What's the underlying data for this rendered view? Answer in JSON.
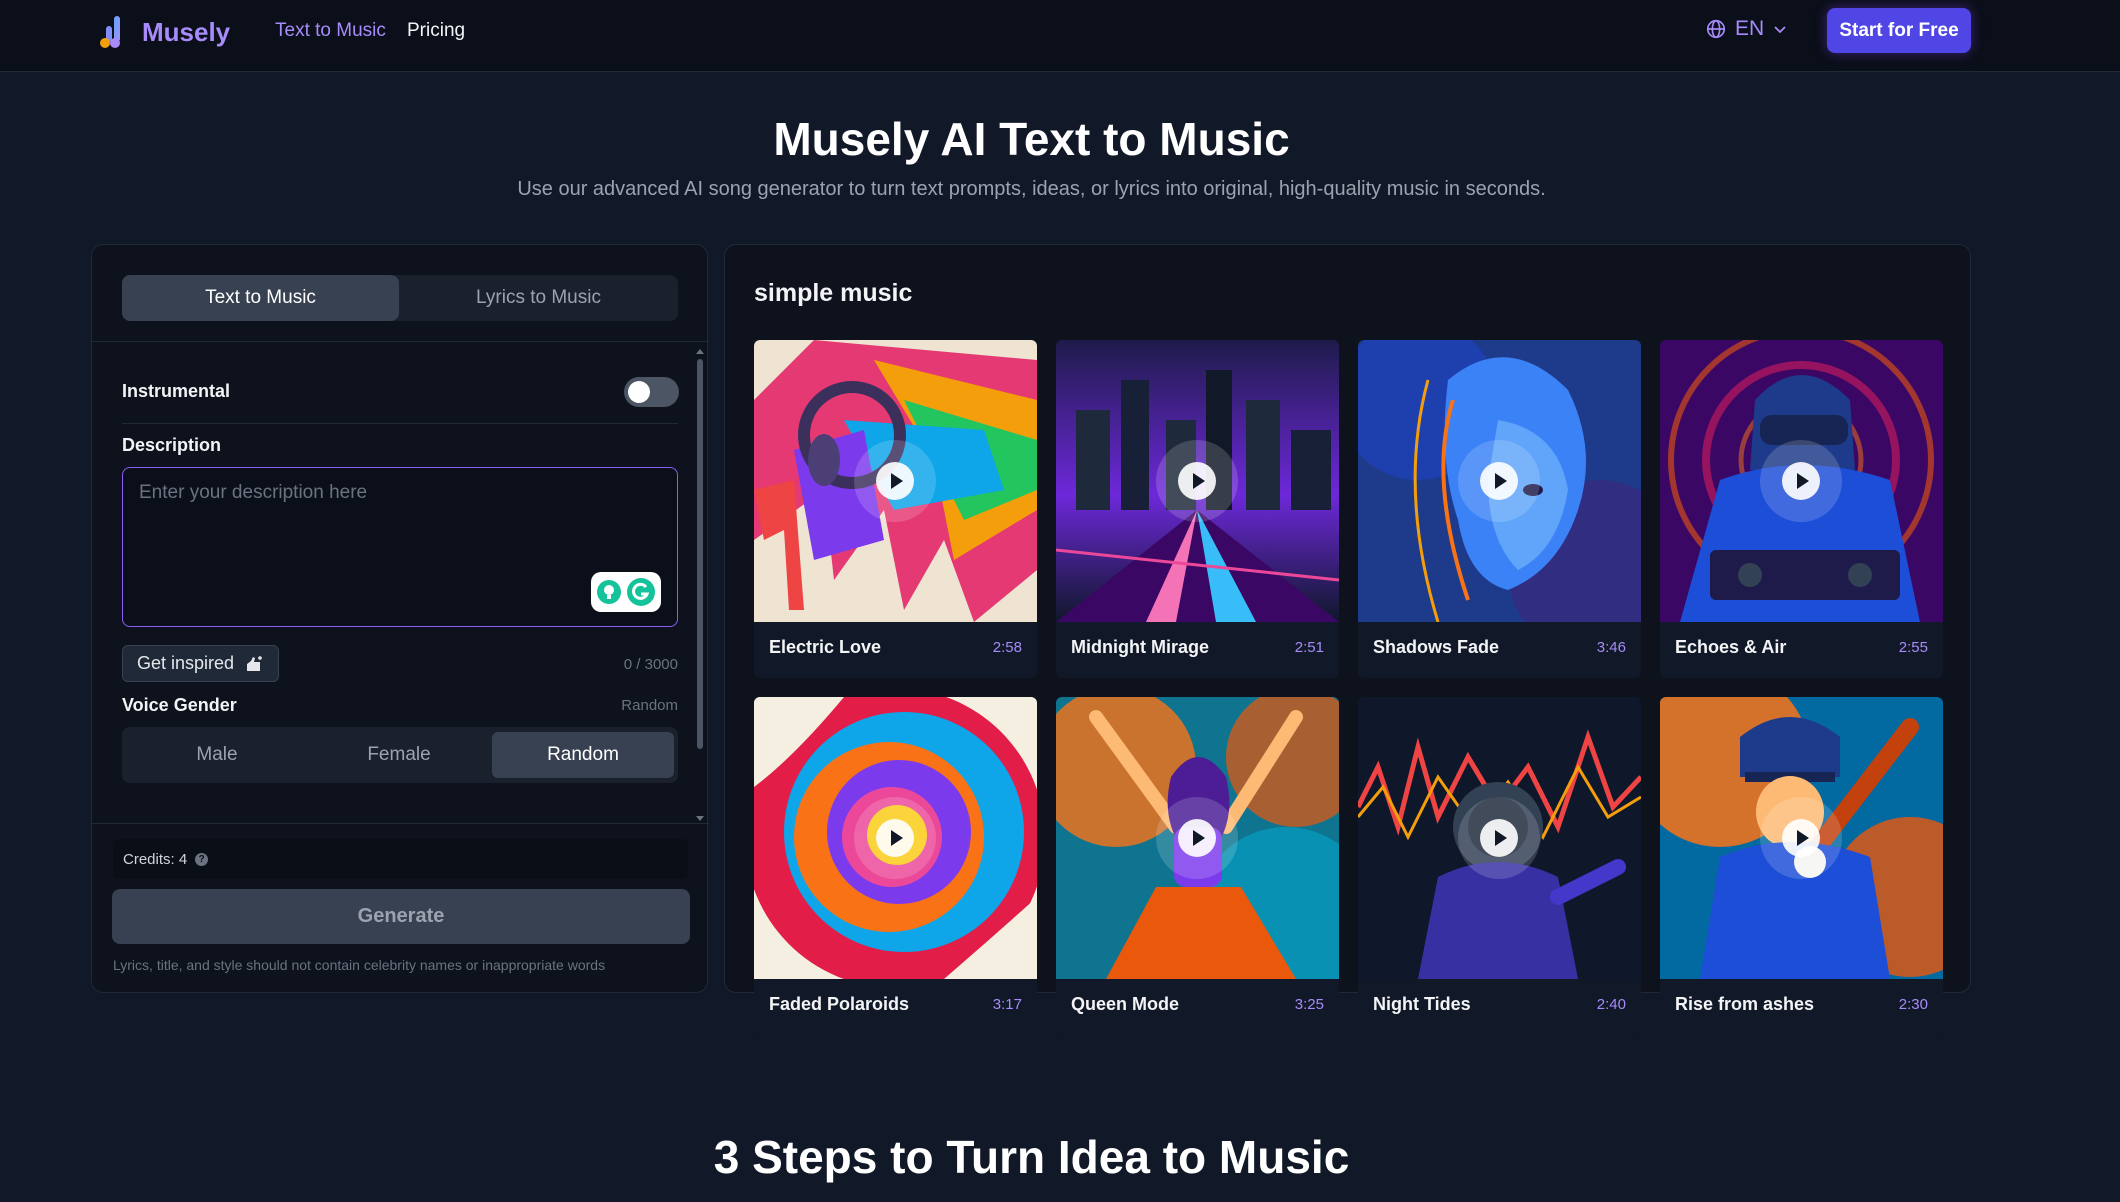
{
  "nav": {
    "brand": "Musely",
    "links": [
      "Text to Music",
      "Pricing"
    ],
    "language": "EN",
    "cta": "Start for Free"
  },
  "hero": {
    "title": "Musely AI Text to Music",
    "subtitle": "Use our advanced AI song generator to turn text prompts, ideas, or lyrics into original, high-quality music in seconds."
  },
  "generator": {
    "tabs": [
      "Text to Music",
      "Lyrics to Music"
    ],
    "active_tab": "Text to Music",
    "instrumental_label": "Instrumental",
    "instrumental_on": false,
    "description_label": "Description",
    "description_placeholder": "Enter your description here",
    "description_value": "",
    "inspire_label": "Get inspired",
    "char_counter": "0 / 3000",
    "voice_gender_label": "Voice Gender",
    "voice_gender_value": "Random",
    "gender_options": [
      "Male",
      "Female",
      "Random"
    ],
    "credits_label": "Credits: 4",
    "generate_label": "Generate",
    "disclaimer": "Lyrics, title, and style should not contain celebrity names or inappropriate words"
  },
  "gallery": {
    "title": "simple music",
    "tracks": [
      {
        "title": "Electric Love",
        "duration": "2:58",
        "art": "paint-headphones"
      },
      {
        "title": "Midnight Mirage",
        "duration": "2:51",
        "art": "neon-city"
      },
      {
        "title": "Shadows Fade",
        "duration": "3:46",
        "art": "robot-woman"
      },
      {
        "title": "Echoes & Air",
        "duration": "2:55",
        "art": "dj-helmet"
      },
      {
        "title": "Faded Polaroids",
        "duration": "3:17",
        "art": "color-swirl"
      },
      {
        "title": "Queen Mode",
        "duration": "3:25",
        "art": "dancer"
      },
      {
        "title": "Night Tides",
        "duration": "2:40",
        "art": "astronaut-wave"
      },
      {
        "title": "Rise from ashes",
        "duration": "2:30",
        "art": "baseball-player"
      }
    ]
  },
  "steps": {
    "title": "3 Steps to Turn Idea to Music"
  },
  "colors": {
    "accent": "#a78bfa",
    "cta": "#4f46e5",
    "background": "#111827",
    "panel": "#0d121d"
  }
}
